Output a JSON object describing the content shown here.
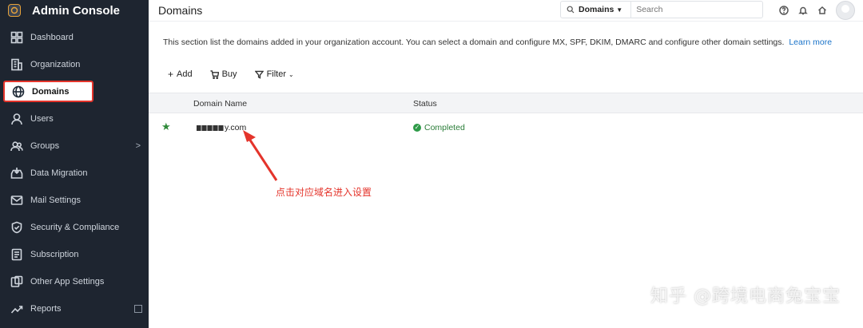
{
  "app": {
    "title": "Admin Console"
  },
  "sidebar": {
    "items": [
      {
        "label": "Dashboard",
        "icon": "dashboard-icon"
      },
      {
        "label": "Organization",
        "icon": "building-icon"
      },
      {
        "label": "Domains",
        "icon": "globe-icon",
        "active": true
      },
      {
        "label": "Users",
        "icon": "user-icon"
      },
      {
        "label": "Groups",
        "icon": "group-icon",
        "chevron": ">"
      },
      {
        "label": "Data Migration",
        "icon": "migration-icon"
      },
      {
        "label": "Mail Settings",
        "icon": "mail-icon"
      },
      {
        "label": "Security & Compliance",
        "icon": "shield-icon"
      },
      {
        "label": "Subscription",
        "icon": "subscription-icon"
      },
      {
        "label": "Other App Settings",
        "icon": "apps-icon"
      },
      {
        "label": "Reports",
        "icon": "chart-icon"
      }
    ]
  },
  "header": {
    "page_title": "Domains",
    "search_scope": "Domains",
    "search_placeholder": "Search"
  },
  "main": {
    "description": "This section list the domains added in your organization account. You can select a domain and configure MX, SPF, DKIM, DMARC and configure other domain settings.",
    "learn_more": "Learn more",
    "toolbar": {
      "add": "Add",
      "buy": "Buy",
      "filter": "Filter"
    },
    "table": {
      "columns": [
        "Domain Name",
        "Status"
      ],
      "rows": [
        {
          "domain_prefix": "",
          "domain_suffix": "y.com",
          "status": "Completed",
          "primary": true
        }
      ]
    }
  },
  "annotation": {
    "text": "点击对应域名进入设置",
    "color": "#e4342b"
  },
  "watermark": {
    "text": "知乎 @跨境电商兔宝宝"
  },
  "colors": {
    "sidebar_bg": "#1e2530",
    "accent_link": "#1a73c9",
    "status_green": "#2a7d38",
    "highlight_red": "#e4342b"
  }
}
